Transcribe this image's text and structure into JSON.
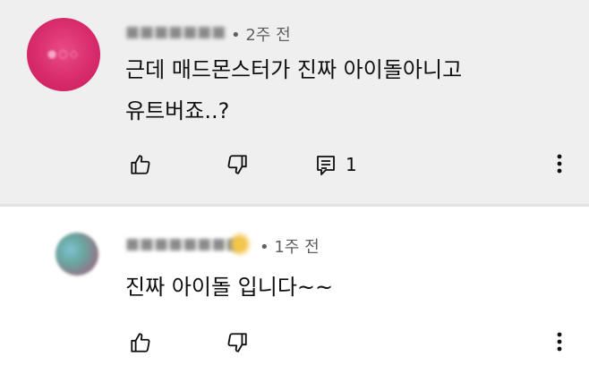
{
  "comments": [
    {
      "author": "■■■■■■■",
      "time": "• 2주 전",
      "lines": [
        "근데 매드몬스터가 진짜 아이돌아니고",
        "유트버죠..?"
      ],
      "reply_count": "1",
      "icons": [
        "thumbs-up-icon",
        "thumbs-down-icon",
        "reply-icon",
        "more-vert-icon"
      ]
    },
    {
      "author": "■■■■■■■■",
      "time": "• 1주 전",
      "lines": [
        "진짜 아이돌 입니다~~"
      ],
      "icons": [
        "thumbs-up-icon",
        "thumbs-down-icon",
        "more-vert-icon"
      ]
    }
  ],
  "colors": {
    "highlight_bg": "#efefef",
    "text": "#0f0f0f",
    "meta": "#606060",
    "avatar1": "#d82b6c"
  }
}
